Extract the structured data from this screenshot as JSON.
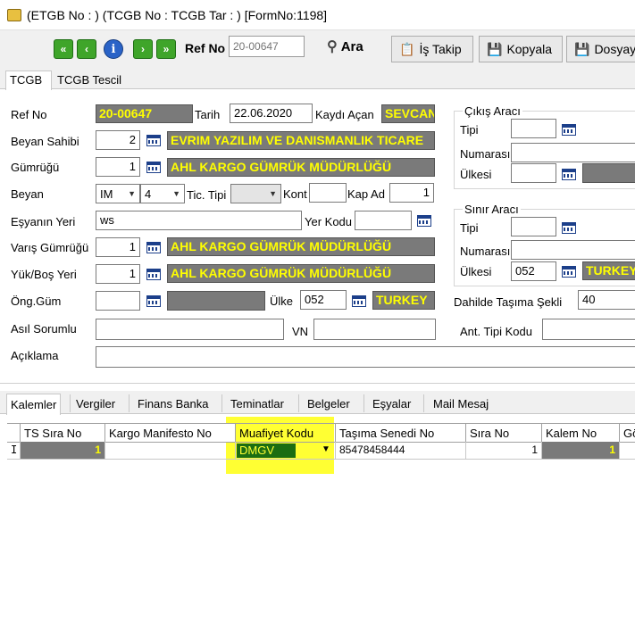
{
  "window": {
    "title": "(ETGB No : ) (TCGB No :  TCGB Tar : ) [FormNo:1198]"
  },
  "toolbar": {
    "first": "«",
    "prev": "‹",
    "info": "i",
    "next": "›",
    "last": "»",
    "ref_label": "Ref No",
    "ref_placeholder": "20-00647",
    "search_label": "Ara",
    "is_takip_label": "İş Takip",
    "kopyala_label": "Kopyala",
    "dosya_label": "Dosyaye"
  },
  "main_tabs": [
    "TCGB",
    "TCGB Tescil"
  ],
  "form": {
    "ref_no_label": "Ref No",
    "ref_no": "20-00647",
    "tarih_label": "Tarih",
    "tarih": "22.06.2020",
    "kaydi_acan_label": "Kaydı Açan",
    "kaydi_acan": "SEVCAN",
    "beyan_sahibi_label": "Beyan Sahibi",
    "beyan_sahibi_code": "2",
    "beyan_sahibi_name": "EVRIM YAZILIM VE DANISMANLIK TICARE",
    "gumrugu_label": "Gümrüğü",
    "gumrugu_code": "1",
    "gumrugu_name": "AHL KARGO GÜMRÜK MÜDÜRLÜĞÜ",
    "beyan_label": "Beyan",
    "beyan_type": "IM",
    "beyan_no": "4",
    "tic_tipi_label": "Tic. Tipi",
    "kont_label": "Kont",
    "kap_ad_label": "Kap Ad",
    "kap_ad": "1",
    "esyanin_yeri_label": "Eşyanın Yeri",
    "esyanin_yeri": "ws",
    "yer_kodu_label": "Yer Kodu",
    "varis_gumrugu_label": "Varış Gümrüğü",
    "varis_code": "1",
    "varis_name": "AHL KARGO GÜMRÜK MÜDÜRLÜĞÜ",
    "yuk_bos_label": "Yük/Boş Yeri",
    "yuk_code": "1",
    "yuk_name": "AHL KARGO GÜMRÜK MÜDÜRLÜĞÜ",
    "ong_gum_label": "Öng.Güm",
    "ulke_label": "Ülke",
    "ulke_code": "052",
    "ulke_name": "TURKEY",
    "asil_sorumlu_label": "Asıl Sorumlu",
    "vn_label": "VN",
    "aciklama_label": "Açıklama"
  },
  "cikis_araci": {
    "legend": "Çıkış Aracı",
    "tipi_label": "Tipi",
    "numarasi_label": "Numarası",
    "ulkesi_label": "Ülkesi"
  },
  "sinir_araci": {
    "legend": "Sınır Aracı",
    "tipi_label": "Tipi",
    "numarasi_label": "Numarası",
    "ulkesi_label": "Ülkesi",
    "ulkesi_code": "052",
    "ulkesi_name": "TURKEY"
  },
  "dahilde": {
    "label": "Dahilde Taşıma Şekli",
    "value": "40"
  },
  "ant_tipi_label": "Ant. Tipi Kodu",
  "sub_tabs": [
    "Kalemler",
    "Vergiler",
    "Finans Banka",
    "Teminatlar",
    "Belgeler",
    "Eşyalar",
    "Mail Mesaj"
  ],
  "grid": {
    "columns": [
      "TS Sıra No",
      "Kargo Manifesto No",
      "Muafiyet Kodu",
      "Taşıma Senedi No",
      "Sıra No",
      "Kalem No",
      "Gö"
    ],
    "rows": [
      {
        "indicator": "I",
        "ts_sira": "1",
        "manifesto": "",
        "muafiyet": "DMGV",
        "tasima": "85478458444",
        "sira": "1",
        "kalem": "1"
      }
    ]
  },
  "colors": {
    "highlight": "#ffff33",
    "field_highlight_bg": "#7a7a7a",
    "field_highlight_text": "#ffff00"
  }
}
